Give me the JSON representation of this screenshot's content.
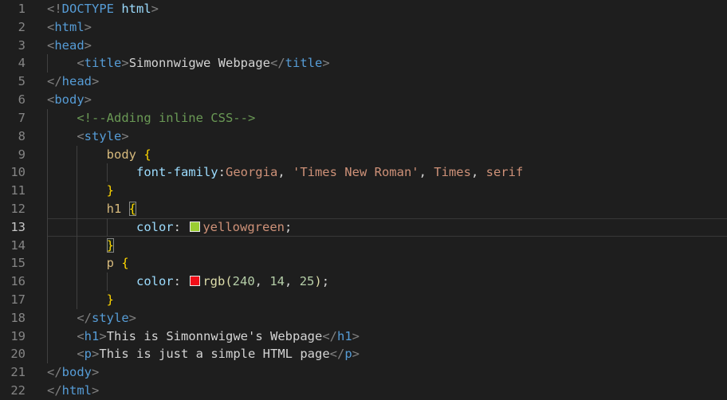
{
  "editor": {
    "current_line": 13,
    "colors": {
      "background": "#1e1e1e",
      "line_number": "#858585",
      "active_line_number": "#c6c6c6",
      "indent_guide": "#404040",
      "current_line_border": "#383838",
      "bracket_match_border": "#888888",
      "swatch_border": "#e8e8e8"
    },
    "palette": {
      "punct": "#808080",
      "tag": "#569cd6",
      "attr": "#9cdcfe",
      "text": "#d4d4d4",
      "plain": "#d4d4d4",
      "comment": "#6a9955",
      "selector": "#d7ba7d",
      "property": "#9cdcfe",
      "value": "#ce9178",
      "number": "#b5cea8",
      "func": "#dcdcaa",
      "brace": "#ffd700",
      "paren": "#dcdcaa"
    },
    "lines": [
      {
        "num": 1,
        "guides": [],
        "tokens": [
          {
            "s": "punct",
            "t": "<!"
          },
          {
            "s": "tag",
            "t": "DOCTYPE"
          },
          {
            "s": "attr",
            "t": " html"
          },
          {
            "s": "punct",
            "t": ">"
          }
        ]
      },
      {
        "num": 2,
        "guides": [],
        "tokens": [
          {
            "s": "punct",
            "t": "<"
          },
          {
            "s": "tag",
            "t": "html"
          },
          {
            "s": "punct",
            "t": ">"
          }
        ]
      },
      {
        "num": 3,
        "guides": [],
        "tokens": [
          {
            "s": "punct",
            "t": "<"
          },
          {
            "s": "tag",
            "t": "head"
          },
          {
            "s": "punct",
            "t": ">"
          }
        ]
      },
      {
        "num": 4,
        "guides": [
          0
        ],
        "tokens": [
          {
            "s": "plain",
            "t": "    "
          },
          {
            "s": "punct",
            "t": "<"
          },
          {
            "s": "tag",
            "t": "title"
          },
          {
            "s": "punct",
            "t": ">"
          },
          {
            "s": "text",
            "t": "Simonnwigwe Webpage"
          },
          {
            "s": "punct",
            "t": "</"
          },
          {
            "s": "tag",
            "t": "title"
          },
          {
            "s": "punct",
            "t": ">"
          }
        ]
      },
      {
        "num": 5,
        "guides": [],
        "tokens": [
          {
            "s": "punct",
            "t": "</"
          },
          {
            "s": "tag",
            "t": "head"
          },
          {
            "s": "punct",
            "t": ">"
          }
        ]
      },
      {
        "num": 6,
        "guides": [],
        "tokens": [
          {
            "s": "punct",
            "t": "<"
          },
          {
            "s": "tag",
            "t": "body"
          },
          {
            "s": "punct",
            "t": ">"
          }
        ]
      },
      {
        "num": 7,
        "guides": [
          0
        ],
        "tokens": [
          {
            "s": "plain",
            "t": "    "
          },
          {
            "s": "comment",
            "t": "<!--Adding inline CSS-->"
          }
        ]
      },
      {
        "num": 8,
        "guides": [
          0
        ],
        "tokens": [
          {
            "s": "plain",
            "t": "    "
          },
          {
            "s": "punct",
            "t": "<"
          },
          {
            "s": "tag",
            "t": "style"
          },
          {
            "s": "punct",
            "t": ">"
          }
        ]
      },
      {
        "num": 9,
        "guides": [
          0,
          4
        ],
        "tokens": [
          {
            "s": "plain",
            "t": "        "
          },
          {
            "s": "selector",
            "t": "body"
          },
          {
            "s": "plain",
            "t": " "
          },
          {
            "s": "brace",
            "t": "{"
          }
        ]
      },
      {
        "num": 10,
        "guides": [
          0,
          4,
          8
        ],
        "tokens": [
          {
            "s": "plain",
            "t": "            "
          },
          {
            "s": "property",
            "t": "font-family"
          },
          {
            "s": "plain",
            "t": ":"
          },
          {
            "s": "value",
            "t": "Georgia"
          },
          {
            "s": "plain",
            "t": ", "
          },
          {
            "s": "value",
            "t": "'Times New Roman'"
          },
          {
            "s": "plain",
            "t": ", "
          },
          {
            "s": "value",
            "t": "Times"
          },
          {
            "s": "plain",
            "t": ", "
          },
          {
            "s": "value",
            "t": "serif"
          }
        ]
      },
      {
        "num": 11,
        "guides": [
          0,
          4
        ],
        "tokens": [
          {
            "s": "plain",
            "t": "        "
          },
          {
            "s": "brace",
            "t": "}"
          }
        ]
      },
      {
        "num": 12,
        "guides": [
          0,
          4
        ],
        "tokens": [
          {
            "s": "plain",
            "t": "        "
          },
          {
            "s": "selector",
            "t": "h1"
          },
          {
            "s": "plain",
            "t": " "
          },
          {
            "s": "brace",
            "t": "{",
            "box": true
          }
        ]
      },
      {
        "num": 13,
        "guides": [
          0,
          4,
          8
        ],
        "tokens": [
          {
            "s": "plain",
            "t": "            "
          },
          {
            "s": "property",
            "t": "color"
          },
          {
            "s": "plain",
            "t": ": "
          },
          {
            "swatch": "#9acd32",
            "name": "yellowgreen"
          },
          {
            "s": "value",
            "t": "yellowgreen"
          },
          {
            "s": "plain",
            "t": ";"
          }
        ]
      },
      {
        "num": 14,
        "guides": [
          0,
          4
        ],
        "tokens": [
          {
            "s": "plain",
            "t": "        "
          },
          {
            "s": "brace",
            "t": "}",
            "box": true
          }
        ]
      },
      {
        "num": 15,
        "guides": [
          0,
          4
        ],
        "tokens": [
          {
            "s": "plain",
            "t": "        "
          },
          {
            "s": "selector",
            "t": "p"
          },
          {
            "s": "plain",
            "t": " "
          },
          {
            "s": "brace",
            "t": "{"
          }
        ]
      },
      {
        "num": 16,
        "guides": [
          0,
          4,
          8
        ],
        "tokens": [
          {
            "s": "plain",
            "t": "            "
          },
          {
            "s": "property",
            "t": "color"
          },
          {
            "s": "plain",
            "t": ": "
          },
          {
            "swatch": "#f00e19",
            "name": "rgb(240, 14, 25)"
          },
          {
            "s": "func",
            "t": "rgb"
          },
          {
            "s": "paren",
            "t": "("
          },
          {
            "s": "number",
            "t": "240"
          },
          {
            "s": "plain",
            "t": ", "
          },
          {
            "s": "number",
            "t": "14"
          },
          {
            "s": "plain",
            "t": ", "
          },
          {
            "s": "number",
            "t": "25"
          },
          {
            "s": "paren",
            "t": ")"
          },
          {
            "s": "plain",
            "t": ";"
          }
        ]
      },
      {
        "num": 17,
        "guides": [
          0,
          4
        ],
        "tokens": [
          {
            "s": "plain",
            "t": "        "
          },
          {
            "s": "brace",
            "t": "}"
          }
        ]
      },
      {
        "num": 18,
        "guides": [
          0
        ],
        "tokens": [
          {
            "s": "plain",
            "t": "    "
          },
          {
            "s": "punct",
            "t": "</"
          },
          {
            "s": "tag",
            "t": "style"
          },
          {
            "s": "punct",
            "t": ">"
          }
        ]
      },
      {
        "num": 19,
        "guides": [
          0
        ],
        "tokens": [
          {
            "s": "plain",
            "t": "    "
          },
          {
            "s": "punct",
            "t": "<"
          },
          {
            "s": "tag",
            "t": "h1"
          },
          {
            "s": "punct",
            "t": ">"
          },
          {
            "s": "text",
            "t": "This is Simonnwigwe's Webpage"
          },
          {
            "s": "punct",
            "t": "</"
          },
          {
            "s": "tag",
            "t": "h1"
          },
          {
            "s": "punct",
            "t": ">"
          }
        ]
      },
      {
        "num": 20,
        "guides": [
          0
        ],
        "tokens": [
          {
            "s": "plain",
            "t": "    "
          },
          {
            "s": "punct",
            "t": "<"
          },
          {
            "s": "tag",
            "t": "p"
          },
          {
            "s": "punct",
            "t": ">"
          },
          {
            "s": "text",
            "t": "This is just a simple HTML page"
          },
          {
            "s": "punct",
            "t": "</"
          },
          {
            "s": "tag",
            "t": "p"
          },
          {
            "s": "punct",
            "t": ">"
          }
        ]
      },
      {
        "num": 21,
        "guides": [],
        "tokens": [
          {
            "s": "punct",
            "t": "</"
          },
          {
            "s": "tag",
            "t": "body"
          },
          {
            "s": "punct",
            "t": ">"
          }
        ]
      },
      {
        "num": 22,
        "guides": [],
        "tokens": [
          {
            "s": "punct",
            "t": "</"
          },
          {
            "s": "tag",
            "t": "html"
          },
          {
            "s": "punct",
            "t": ">"
          }
        ]
      }
    ]
  }
}
